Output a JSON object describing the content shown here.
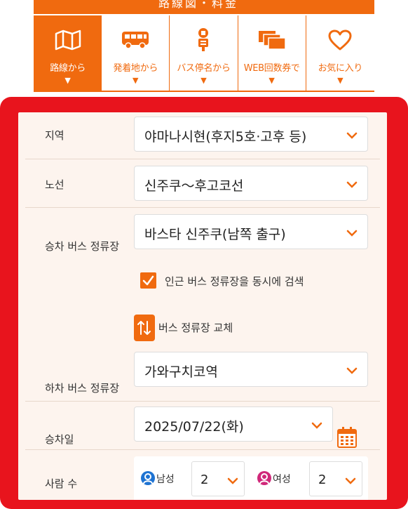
{
  "header": {
    "title_fragment": "路線図・料金"
  },
  "tabs": [
    {
      "label": "路線から",
      "icon": "map-icon",
      "active": true
    },
    {
      "label": "発着地から",
      "icon": "bus-icon",
      "active": false
    },
    {
      "label": "バス停名から",
      "icon": "bus-stop-icon",
      "active": false
    },
    {
      "label": "WEB回数券で",
      "icon": "tickets-icon",
      "active": false
    },
    {
      "label": "お気に入り",
      "icon": "heart-icon",
      "active": false
    }
  ],
  "tab_arrow": "▼",
  "form": {
    "region": {
      "label": "지역",
      "value": "야마나시현(후지5호·고후 등)"
    },
    "route": {
      "label": "노선",
      "value": "신주쿠～후고코선"
    },
    "boarding": {
      "label": "승차 버스 정류장",
      "value": "바스타 신주쿠(남쪽 출구)"
    },
    "nearby_checkbox": {
      "label": "인근 버스 정류장을 동시에 검색",
      "checked": true
    },
    "swap_label": "버스 정류장 교체",
    "alighting": {
      "label": "하차 버스 정류장",
      "value": "가와구치코역"
    },
    "date": {
      "label": "승차일",
      "value": "2025/07/22(화)"
    },
    "passengers": {
      "label": "사람 수",
      "male_label": "남성",
      "male_count": "2",
      "female_label": "여성",
      "female_count": "2"
    }
  },
  "colors": {
    "accent": "#f06a0f",
    "highlight_frame": "#e8141d",
    "panel_bg": "#fdf4ee",
    "male_icon": "#1e73d2",
    "female_icon": "#d0287a"
  }
}
